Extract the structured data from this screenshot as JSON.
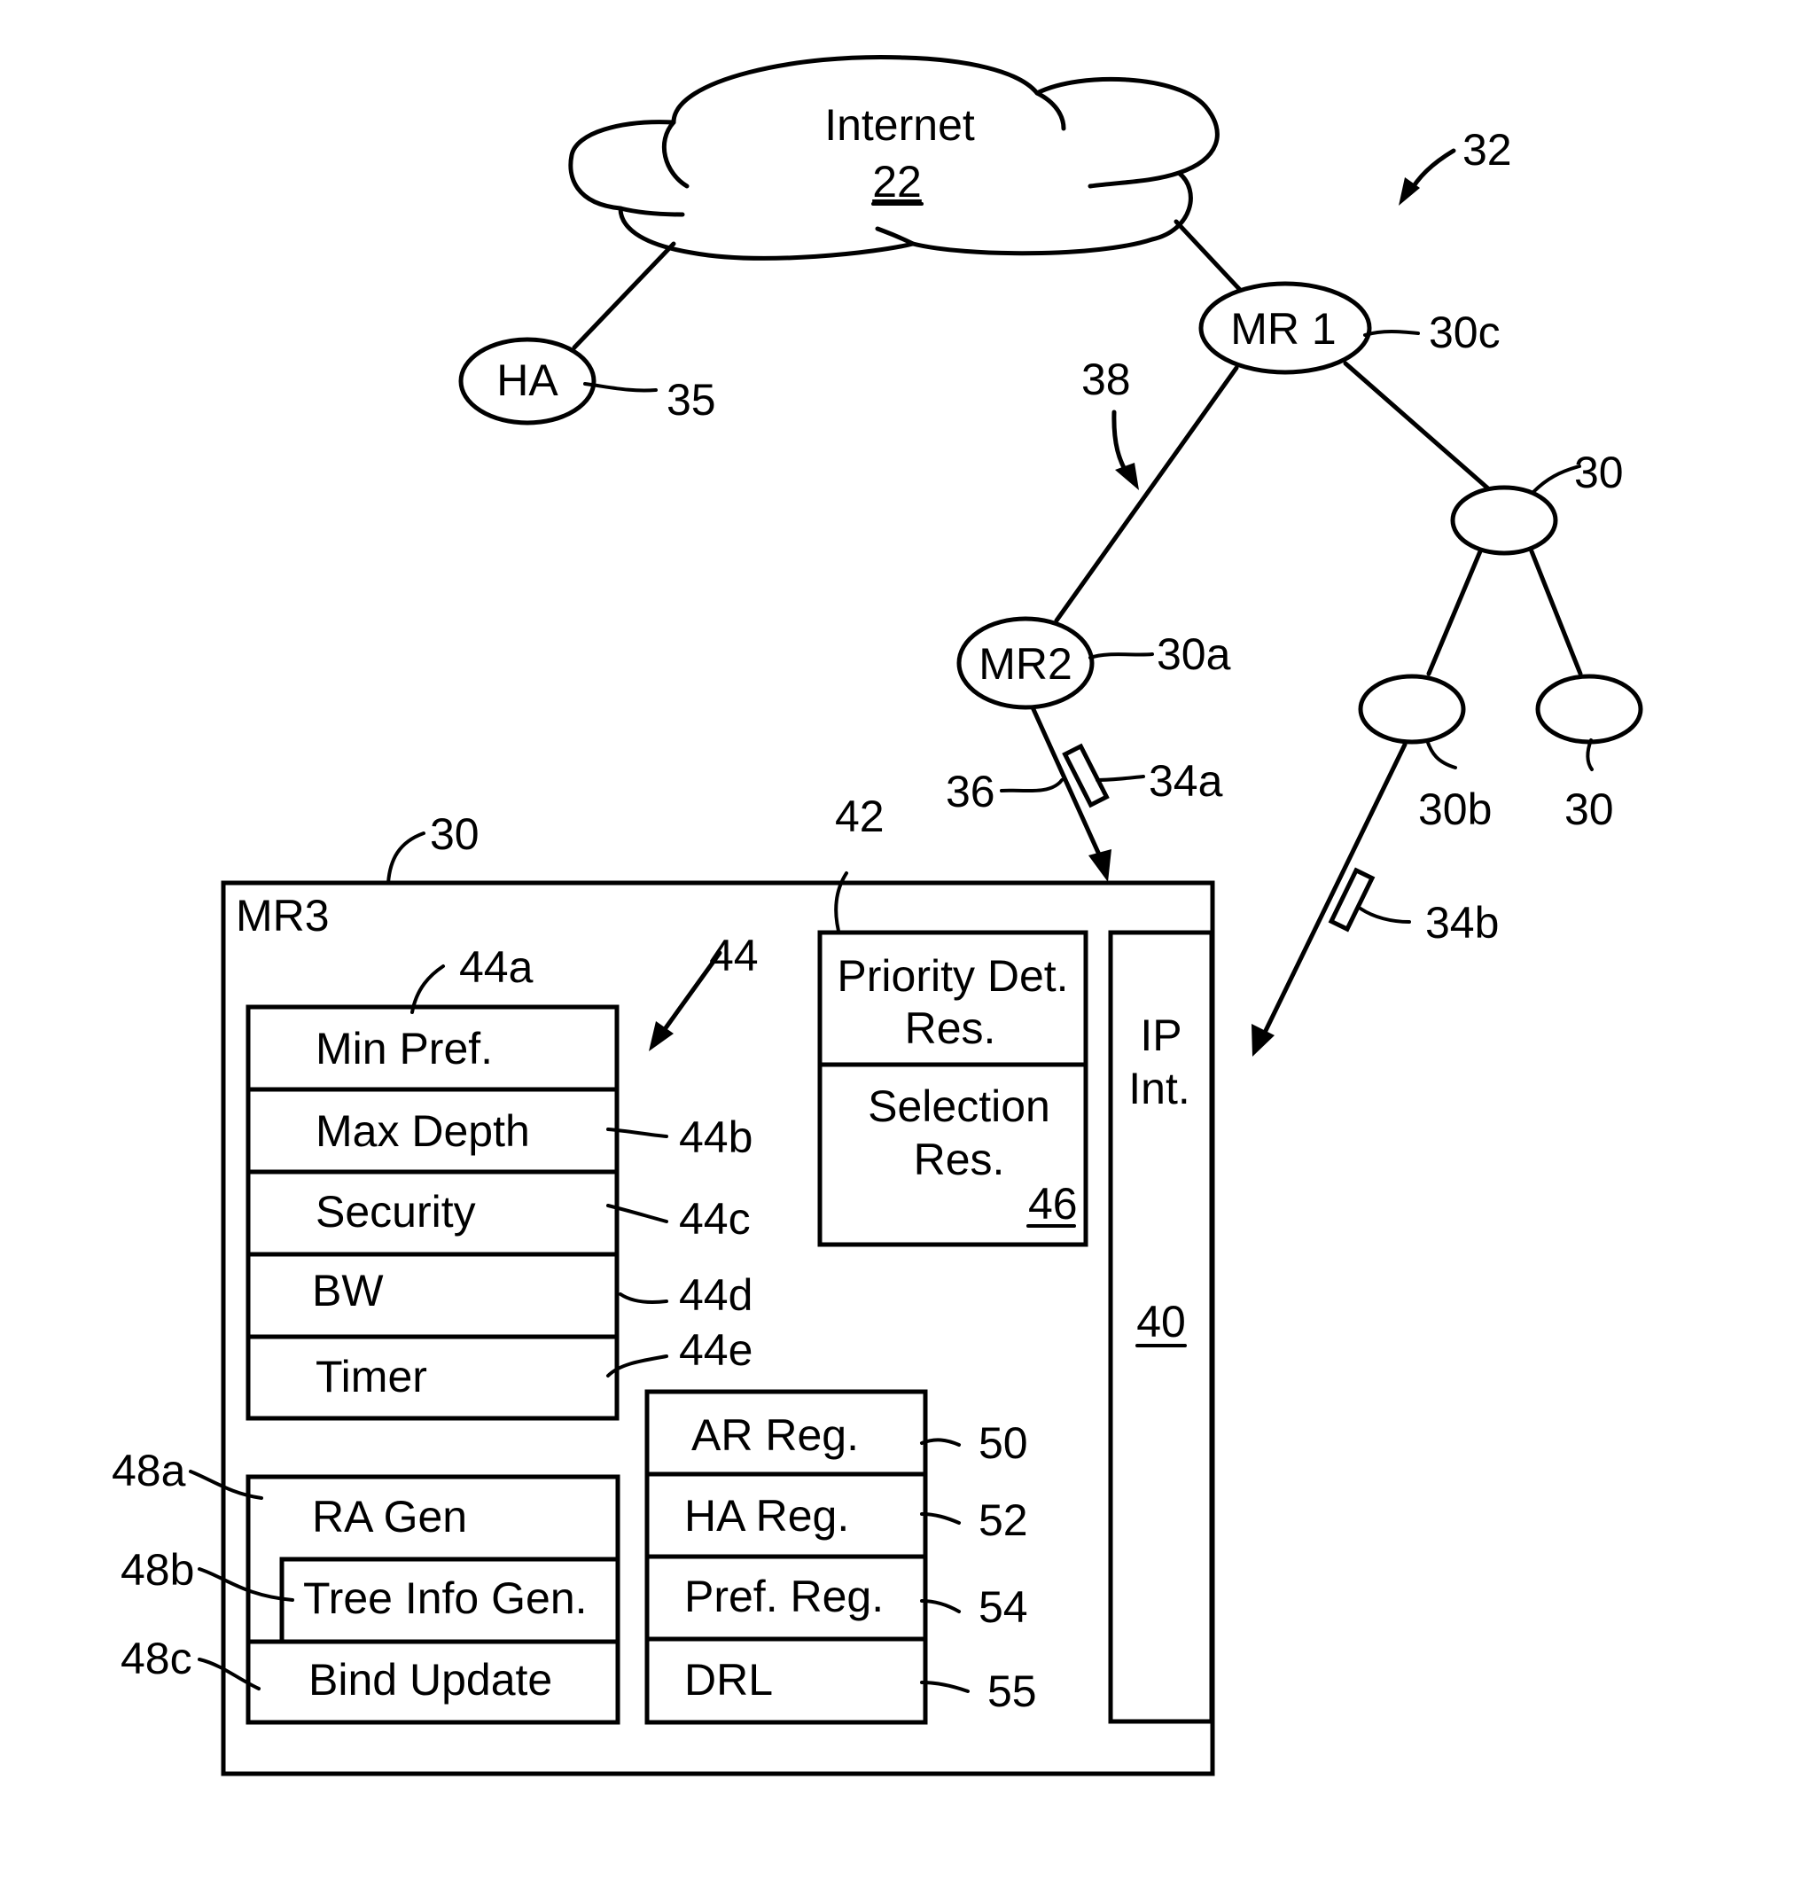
{
  "figure": {
    "ref": "32",
    "internet": {
      "label": "Internet",
      "ref": "22"
    },
    "home_agent": {
      "label": "HA",
      "ref": "35"
    },
    "mr1": {
      "label": "MR 1",
      "ref": "30c"
    },
    "mr2": {
      "label": "MR2",
      "ref": "30a"
    },
    "unnamed_router_top": {
      "ref": "30"
    },
    "unnamed_router_left": {
      "ref": "30b"
    },
    "unnamed_router_right": {
      "ref": "30"
    },
    "link_ref_38": "38",
    "link_ref_36": "36",
    "packet_a": "34a",
    "packet_b": "34b",
    "mr3": {
      "label": "MR3",
      "ref": "30",
      "attributes_table": {
        "ref": "44",
        "rows": [
          {
            "label": "Min Pref.",
            "ref": "44a"
          },
          {
            "label": "Max Depth",
            "ref": "44b"
          },
          {
            "label": "Security",
            "ref": "44c"
          },
          {
            "label": "BW",
            "ref": "44d"
          },
          {
            "label": "Timer",
            "ref": "44e"
          }
        ]
      },
      "priority_box": {
        "ref": "42",
        "top_line1": "Priority Det.",
        "top_line2": "Res.",
        "bottom_line1": "Selection",
        "bottom_line2": "Res.",
        "bottom_ref": "46"
      },
      "ip_interface": {
        "line1": "IP",
        "line2": "Int.",
        "ref": "40"
      },
      "generators": [
        {
          "label": "RA Gen",
          "ref": "48a"
        },
        {
          "label": "Tree Info Gen.",
          "ref": "48b"
        },
        {
          "label": "Bind Update",
          "ref": "48c"
        }
      ],
      "registers": [
        {
          "label": "AR Reg.",
          "ref": "50"
        },
        {
          "label": "HA Reg.",
          "ref": "52"
        },
        {
          "label": "Pref. Reg.",
          "ref": "54"
        },
        {
          "label": "DRL",
          "ref": "55"
        }
      ]
    }
  }
}
